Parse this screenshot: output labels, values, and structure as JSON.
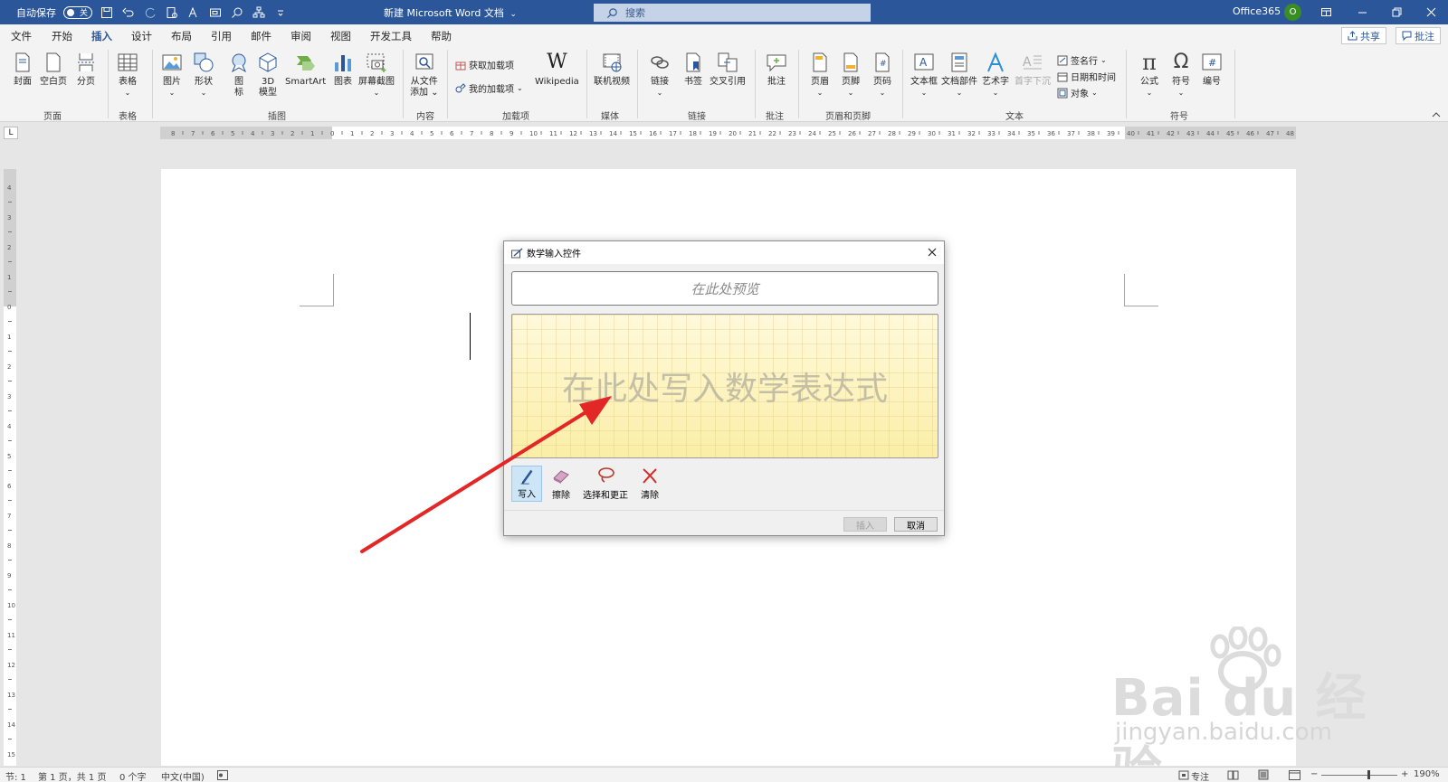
{
  "titlebar": {
    "autosave_label": "自动保存",
    "autosave_state": "关",
    "doc_title": "新建 Microsoft Word 文档",
    "doc_title_caret": "⌄",
    "search_placeholder": "搜索",
    "account": "Office365",
    "avatar_letter": "O"
  },
  "menu": {
    "tabs": [
      "文件",
      "开始",
      "插入",
      "设计",
      "布局",
      "引用",
      "邮件",
      "审阅",
      "视图",
      "开发工具",
      "帮助"
    ],
    "active_tab": "插入",
    "share": "共享",
    "comments": "批注"
  },
  "ribbon": {
    "cover": "封面",
    "blank_page": "空白页",
    "page_break": "分页",
    "table": "表格",
    "picture": "图片",
    "shapes": "形状",
    "icons_1": "图",
    "icons_2": "标",
    "model3d_1": "3D",
    "model3d_2": "模型",
    "smartart": "SmartArt",
    "chart": "图表",
    "screenshot": "屏幕截图",
    "from_file_1": "从文件",
    "from_file_2": "添加",
    "get_addins": "获取加载项",
    "my_addins": "我的加载项",
    "wikipedia": "Wikipedia",
    "online_video": "联机视频",
    "link": "链接",
    "bookmark": "书签",
    "cross_ref": "交叉引用",
    "comment": "批注",
    "header": "页眉",
    "footer": "页脚",
    "page_number": "页码",
    "textbox": "文本框",
    "quick_parts": "文档部件",
    "wordart": "艺术字",
    "drop_cap": "首字下沉",
    "signature_line": "签名行",
    "date_time": "日期和时间",
    "object": "对象",
    "equation": "公式",
    "symbol": "符号",
    "number": "编号",
    "groups": {
      "pages": "页面",
      "tables": "表格",
      "illustrations": "插图",
      "content": "内容",
      "addins": "加载项",
      "media": "媒体",
      "links": "链接",
      "comments": "批注",
      "header_footer": "页眉和页脚",
      "text": "文本",
      "symbols": "符号"
    }
  },
  "ruler": {
    "corner": "L"
  },
  "dialog": {
    "title": "数学输入控件",
    "preview_placeholder": "在此处预览",
    "write_placeholder": "在此处写入数学表达式",
    "tools": {
      "write": "写入",
      "erase": "擦除",
      "select_correct": "选择和更正",
      "clear": "清除"
    },
    "insert": "插入",
    "cancel": "取消"
  },
  "watermark": {
    "brand": "Bai du 经验",
    "url": "jingyan.baidu.com"
  },
  "status": {
    "section": "节: 1",
    "page": "第 1 页，共 1 页",
    "words": "0 个字",
    "language": "中文(中国)",
    "focus": "专注",
    "zoom": "190%",
    "zoom_minus": "−",
    "zoom_plus": "+"
  },
  "colors": {
    "title_bar": "#2b579a",
    "arrow": "#e32626",
    "pad_yellow": "#fff6c8"
  }
}
